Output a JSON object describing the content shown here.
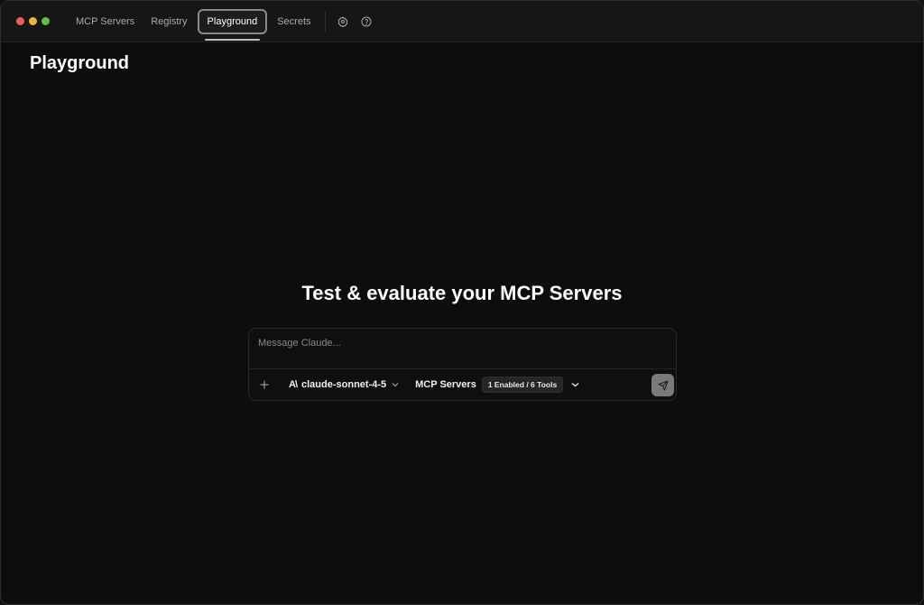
{
  "nav": {
    "tabs": [
      {
        "label": "MCP Servers"
      },
      {
        "label": "Registry"
      },
      {
        "label": "Playground",
        "active": true
      },
      {
        "label": "Secrets"
      }
    ],
    "icons": [
      "gear-icon",
      "help-circle-icon"
    ]
  },
  "page": {
    "title": "Playground",
    "hero": "Test & evaluate your MCP Servers"
  },
  "composer": {
    "placeholder": "Message Claude...",
    "value": "",
    "model_logo": "A\\",
    "model": "claude-sonnet-4-5",
    "servers_label": "MCP Servers",
    "servers_badge": "1 Enabled / 6 Tools",
    "icons": [
      "plus-icon",
      "chevron-down-icon",
      "send-icon"
    ]
  },
  "colors": {
    "background": "#0d0d0d",
    "titlebar": "#161616",
    "send_button": "#7a7a7a",
    "traffic_red": "#ec5f57",
    "traffic_yellow": "#e6b634",
    "traffic_green": "#5dbf47"
  }
}
